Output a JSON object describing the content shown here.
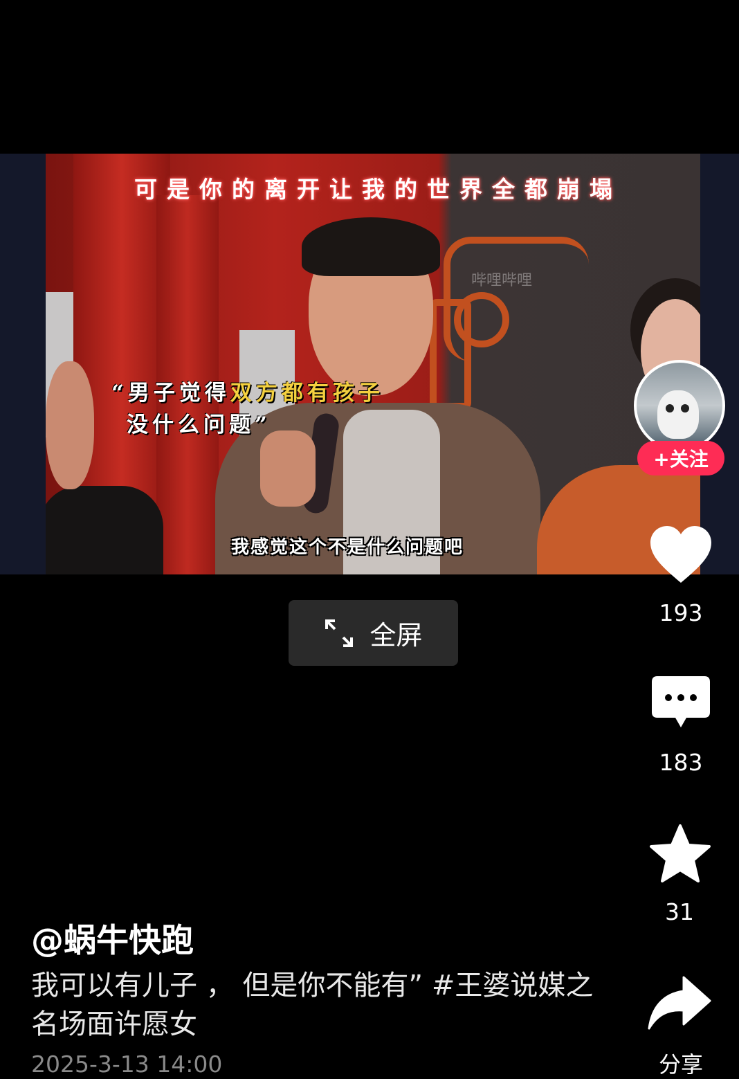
{
  "video": {
    "top_subtitle": "可是你的离开让我的世界全都崩塌",
    "quote_line1_white": "“男子觉得",
    "quote_line1_yellow": "双方都有孩子",
    "quote_line2": "没什么问题”",
    "bottom_subtitle": "我感觉这个不是什么问题吧",
    "watermark": "哔哩哔哩"
  },
  "fullscreen": {
    "label": "全屏",
    "icon": "expand-arrows-icon"
  },
  "rail": {
    "follow_label": "+关注",
    "likes": "193",
    "comments": "183",
    "favorites": "31",
    "share_label": "分享"
  },
  "post": {
    "author": "@蜗牛快跑",
    "caption": "我可以有儿子 ， 但是你不能有” #王婆说媒之名场面许愿女",
    "date": "2025-3-13 14:00"
  },
  "colors": {
    "follow": "#fe2c55",
    "highlight": "#f4d03f"
  }
}
